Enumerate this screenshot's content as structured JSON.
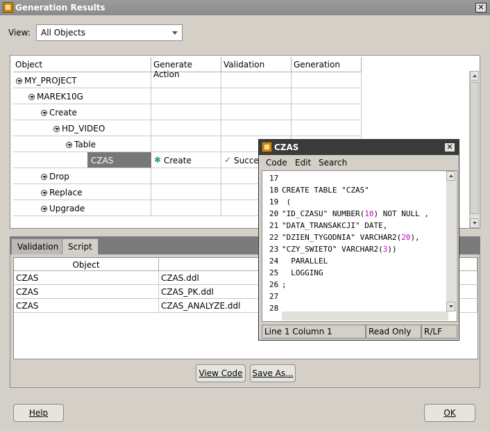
{
  "window": {
    "title": "Generation Results"
  },
  "view": {
    "label": "View:",
    "selected": "All Objects"
  },
  "tree_table": {
    "headers": [
      "Object",
      "Generate Action",
      "Validation",
      "Generation"
    ],
    "rows": [
      {
        "name": "MY_PROJECT",
        "indent": 0,
        "toggle": true,
        "action": "",
        "validation": ""
      },
      {
        "name": "MAREK10G",
        "indent": 1,
        "toggle": true,
        "action": "",
        "validation": ""
      },
      {
        "name": "Create",
        "indent": 2,
        "toggle": true,
        "action": "",
        "validation": ""
      },
      {
        "name": "HD_VIDEO",
        "indent": 3,
        "toggle": true,
        "action": "",
        "validation": ""
      },
      {
        "name": "Table",
        "indent": 4,
        "toggle": true,
        "action": "",
        "validation": ""
      },
      {
        "name": "CZAS",
        "indent": 5,
        "toggle": false,
        "action": "Create",
        "validation": "Succe"
      },
      {
        "name": "Drop",
        "indent": 2,
        "toggle": true,
        "action": "",
        "validation": ""
      },
      {
        "name": "Replace",
        "indent": 2,
        "toggle": true,
        "action": "",
        "validation": ""
      },
      {
        "name": "Upgrade",
        "indent": 2,
        "toggle": true,
        "action": "",
        "validation": ""
      }
    ]
  },
  "tabs": [
    "Validation",
    "Script"
  ],
  "script_table": {
    "headers": [
      "Object",
      "Script"
    ],
    "rows": [
      [
        "CZAS",
        "CZAS.ddl"
      ],
      [
        "CZAS",
        "CZAS_PK.ddl"
      ],
      [
        "CZAS",
        "CZAS_ANALYZE.ddl"
      ]
    ]
  },
  "buttons": {
    "view_code": "View Code",
    "save_as": "Save As...",
    "help": "Help",
    "ok": "OK"
  },
  "czas_window": {
    "title": "CZAS",
    "menu": [
      "Code",
      "Edit",
      "Search"
    ],
    "lines": [
      {
        "n": "17",
        "text": ""
      },
      {
        "n": "18",
        "text": "CREATE TABLE \"CZAS\""
      },
      {
        "n": "19",
        "text": " ("
      },
      {
        "n": "20",
        "text": "\"ID_CZASU\" NUMBER(",
        "num": "10",
        "rest": ") NOT NULL ,"
      },
      {
        "n": "21",
        "text": "\"DATA_TRANSAKCJI\" DATE,"
      },
      {
        "n": "22",
        "text": "\"DZIEN_TYGODNIA\" VARCHAR2(",
        "num": "20",
        "rest": "),"
      },
      {
        "n": "23",
        "text": "\"CZY_SWIETO\" VARCHAR2(",
        "num": "3",
        "rest": "))"
      },
      {
        "n": "24",
        "text": "  PARALLEL"
      },
      {
        "n": "25",
        "text": "  LOGGING"
      },
      {
        "n": "26",
        "text": ";"
      },
      {
        "n": "27",
        "text": ""
      },
      {
        "n": "28",
        "text": ""
      }
    ],
    "status": {
      "position": "Line 1 Column 1",
      "mode": "Read Only",
      "eol": "R/LF"
    }
  }
}
